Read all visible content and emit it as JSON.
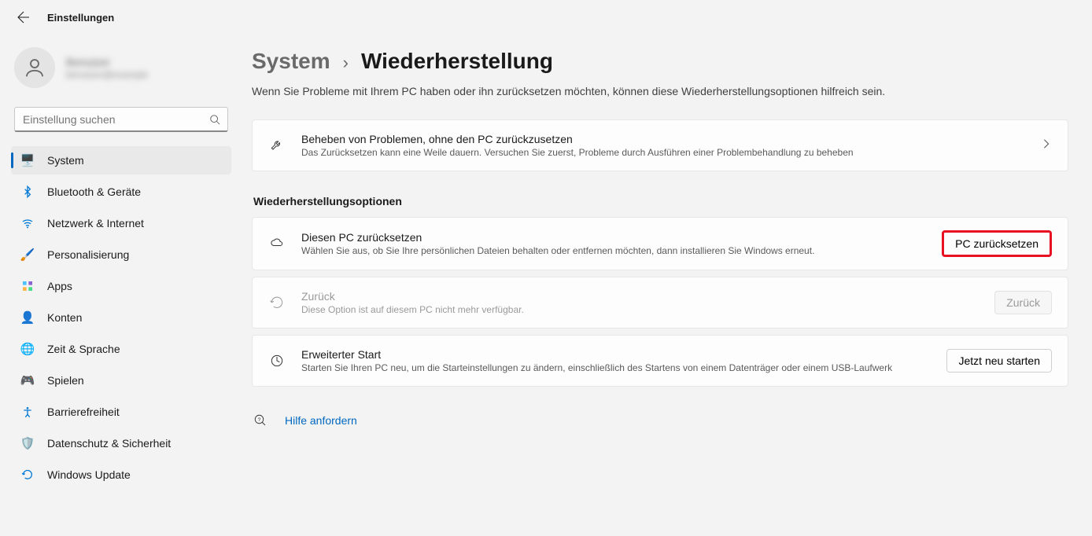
{
  "header": {
    "title": "Einstellungen"
  },
  "profile": {
    "name": "Benutzer",
    "sub": "benutzer@example"
  },
  "search": {
    "placeholder": "Einstellung suchen"
  },
  "nav": {
    "items": [
      {
        "label": "System",
        "icon": "🖥️",
        "active": true
      },
      {
        "label": "Bluetooth & Geräte",
        "icon": "bt"
      },
      {
        "label": "Netzwerk & Internet",
        "icon": "wifi"
      },
      {
        "label": "Personalisierung",
        "icon": "🖌️"
      },
      {
        "label": "Apps",
        "icon": "apps"
      },
      {
        "label": "Konten",
        "icon": "👤"
      },
      {
        "label": "Zeit & Sprache",
        "icon": "🌐"
      },
      {
        "label": "Spielen",
        "icon": "🎮"
      },
      {
        "label": "Barrierefreiheit",
        "icon": "acc"
      },
      {
        "label": "Datenschutz & Sicherheit",
        "icon": "🛡️"
      },
      {
        "label": "Windows Update",
        "icon": "update"
      }
    ]
  },
  "breadcrumb": {
    "parent": "System",
    "sep": "›",
    "current": "Wiederherstellung"
  },
  "page_desc": "Wenn Sie Probleme mit Ihrem PC haben oder ihn zurücksetzen möchten, können diese Wiederherstellungsoptionen hilfreich sein.",
  "troubleshoot": {
    "title": "Beheben von Problemen, ohne den PC zurückzusetzen",
    "desc": "Das Zurücksetzen kann eine Weile dauern. Versuchen Sie zuerst, Probleme durch Ausführen einer Problembehandlung zu beheben"
  },
  "section_title": "Wiederherstellungsoptionen",
  "reset": {
    "title": "Diesen PC zurücksetzen",
    "desc": "Wählen Sie aus, ob Sie Ihre persönlichen Dateien behalten oder entfernen möchten, dann installieren Sie Windows erneut.",
    "button": "PC zurücksetzen"
  },
  "goback": {
    "title": "Zurück",
    "desc": "Diese Option ist auf diesem PC nicht mehr verfügbar.",
    "button": "Zurück"
  },
  "advanced": {
    "title": "Erweiterter Start",
    "desc": "Starten Sie Ihren PC neu, um die Starteinstellungen zu ändern, einschließlich des Startens von einem Datenträger oder einem USB-Laufwerk",
    "button": "Jetzt neu starten"
  },
  "help": {
    "label": "Hilfe anfordern"
  }
}
